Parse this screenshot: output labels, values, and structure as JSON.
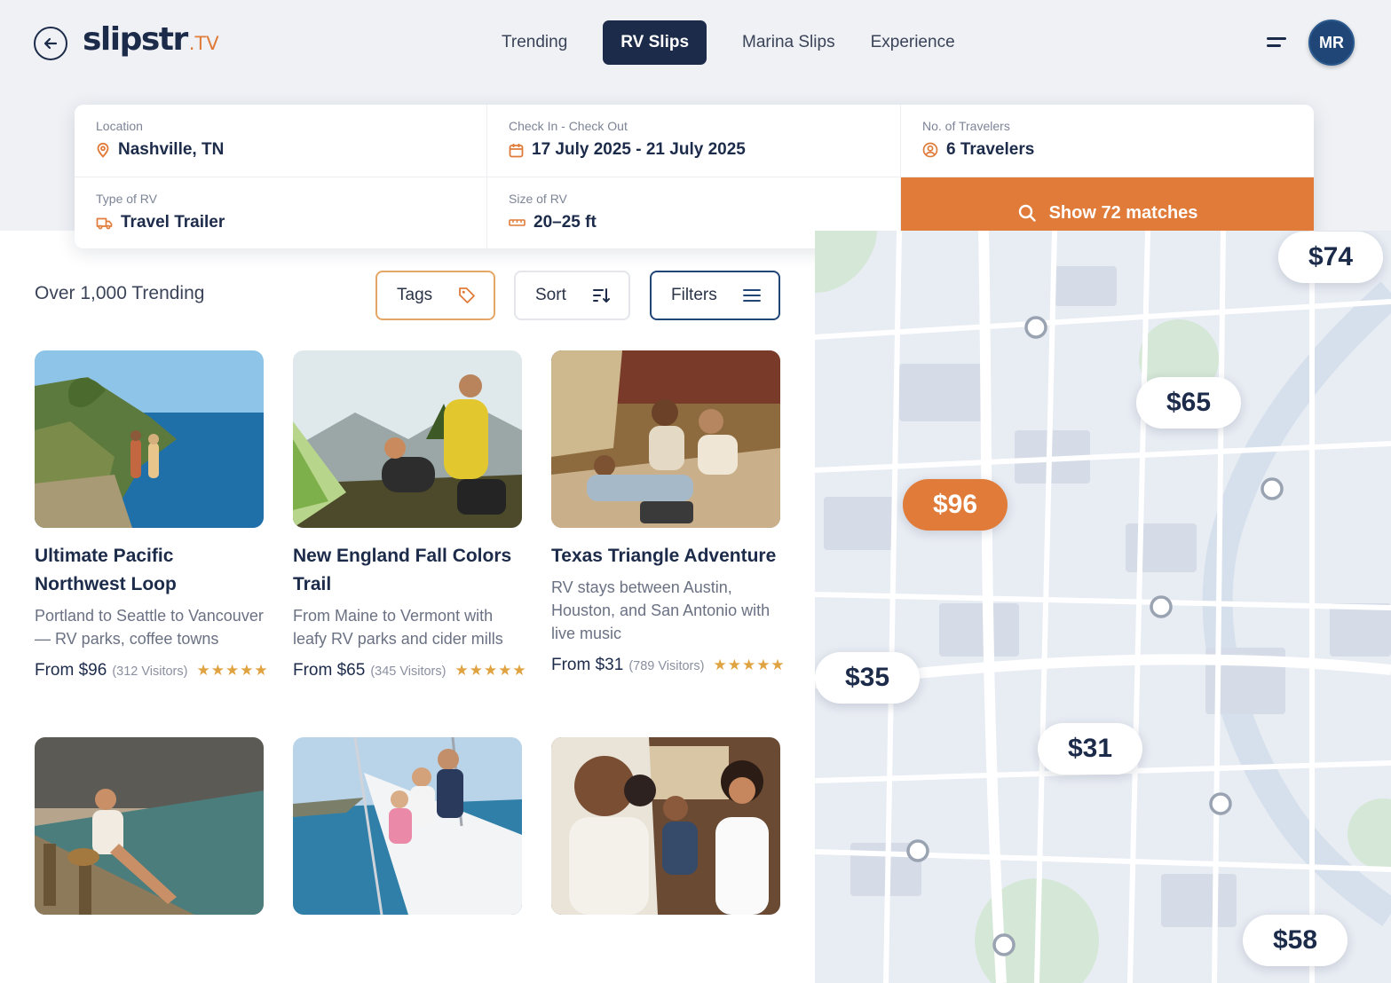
{
  "brand": {
    "name": "slipstr",
    "suffix": ".TV"
  },
  "nav": {
    "tabs": [
      "Trending",
      "RV Slips",
      "Marina Slips",
      "Experience"
    ],
    "active": "RV Slips"
  },
  "user": {
    "initials": "MR"
  },
  "search": {
    "location": {
      "label": "Location",
      "value": "Nashville, TN"
    },
    "dates": {
      "label": "Check In - Check Out",
      "value": "17 July 2025 - 21 July 2025"
    },
    "travelers": {
      "label": "No. of Travelers",
      "value": "6 Travelers"
    },
    "rv_type": {
      "label": "Type of RV",
      "value": "Travel Trailer"
    },
    "rv_size": {
      "label": "Size of RV",
      "value": "20–25 ft"
    },
    "submit_label": "Show 72 matches"
  },
  "listing": {
    "heading": "Over 1,000 Trending",
    "tags_label": "Tags",
    "sort_label": "Sort",
    "filters_label": "Filters"
  },
  "cards": [
    {
      "title": "Ultimate Pacific Northwest Loop",
      "desc": "Portland to Seattle to Vancouver — RV parks, coffee towns",
      "price": "From $96",
      "visitors": "(312 Visitors)",
      "rating": 5
    },
    {
      "title": "New England Fall Colors Trail",
      "desc": "From Maine to Vermont with leafy RV parks and cider mills",
      "price": "From $65",
      "visitors": "(345 Visitors)",
      "rating": 5
    },
    {
      "title": "Texas Triangle Adventure",
      "desc": "RV stays between Austin, Houston, and San Antonio with live music",
      "price": "From $31",
      "visitors": "(789 Visitors)",
      "rating": 5
    },
    {
      "title": "",
      "desc": "",
      "price": "",
      "visitors": ""
    },
    {
      "title": "",
      "desc": "",
      "price": "",
      "visitors": ""
    },
    {
      "title": "",
      "desc": "",
      "price": "",
      "visitors": ""
    }
  ],
  "stars": "★★★★★",
  "map": {
    "price_pins": [
      "$74",
      "$65",
      "$96",
      "$35",
      "$31",
      "$58"
    ],
    "selected_pin": "$96"
  },
  "colors": {
    "navy": "#1c2b4a",
    "accent": "#e07b39",
    "star": "#e0a341",
    "map_bg": "#e8ecf3"
  }
}
